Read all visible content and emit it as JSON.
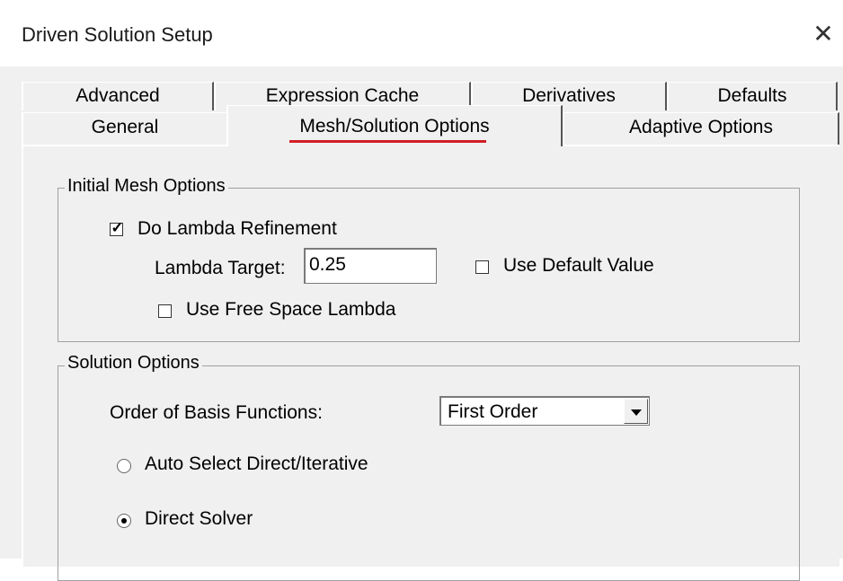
{
  "window": {
    "title": "Driven Solution Setup",
    "close_glyph": "✕"
  },
  "tabs": {
    "back_row": [
      "Advanced",
      "Expression Cache",
      "Derivatives",
      "Defaults"
    ],
    "front_row": [
      "General",
      "Mesh/Solution Options",
      "Adaptive Options"
    ],
    "selected": "Mesh/Solution Options"
  },
  "initial_mesh": {
    "group_label": "Initial Mesh Options",
    "do_lambda_refinement": {
      "label": "Do Lambda Refinement",
      "checked": true
    },
    "lambda_target": {
      "label": "Lambda Target:",
      "value": "0.25"
    },
    "use_default_value": {
      "label": "Use Default Value",
      "checked": false
    },
    "use_free_space_lambda": {
      "label": "Use Free Space Lambda",
      "checked": false
    }
  },
  "solution_options": {
    "group_label": "Solution Options",
    "order_label": "Order of Basis Functions:",
    "order_value": "First Order",
    "auto_select": {
      "label": "Auto Select Direct/Iterative",
      "selected": false
    },
    "direct_solver": {
      "label": "Direct Solver",
      "selected": true
    }
  },
  "colors": {
    "client_bg": "#f0f0f0",
    "active_tab_underline": "#d21f26"
  }
}
